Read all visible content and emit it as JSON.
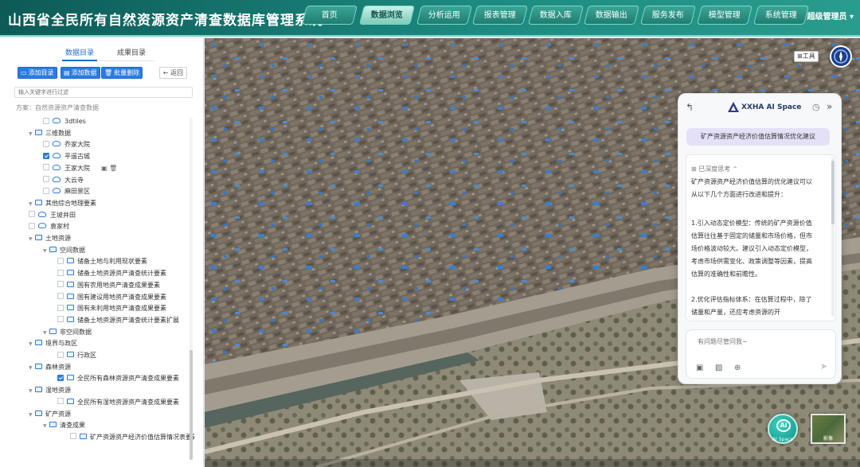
{
  "header": {
    "title": "山西省全民所有自然资源资产清查数据库管理系统",
    "nav": [
      {
        "label": "首页",
        "active": false
      },
      {
        "label": "数据浏览",
        "active": true
      },
      {
        "label": "分析运用",
        "active": false
      },
      {
        "label": "报表管理",
        "active": false
      },
      {
        "label": "数据入库",
        "active": false
      },
      {
        "label": "数据输出",
        "active": false
      },
      {
        "label": "服务发布",
        "active": false
      },
      {
        "label": "模型管理",
        "active": false
      },
      {
        "label": "系统管理",
        "active": false
      }
    ],
    "user": "超级管理员",
    "user_caret": "▾"
  },
  "sidebar": {
    "tabs": [
      {
        "label": "数据目录",
        "active": true
      },
      {
        "label": "成果目录",
        "active": false
      }
    ],
    "buttons": {
      "add_dir": "添加目录",
      "add_data": "添加数据",
      "batch_delete": "批量删除",
      "back": "返回"
    },
    "search_placeholder": "输入关键字进行过滤",
    "scheme": "方案：自然资源资产清查数据",
    "tree": [
      {
        "label": "3dtiles",
        "checked": false,
        "icon": "model"
      },
      {
        "label": "三维数据",
        "checked": false,
        "icon": "folder",
        "open": true
      },
      {
        "label": "乔家大院",
        "checked": false,
        "icon": "model"
      },
      {
        "label": "平遥古城",
        "checked": true,
        "icon": "model"
      },
      {
        "label": "王家大院",
        "checked": false,
        "icon": "model",
        "tools": "▣ 🗑"
      },
      {
        "label": "大云寺",
        "checked": false,
        "icon": "model"
      },
      {
        "label": "麻田景区",
        "checked": false,
        "icon": "model"
      },
      {
        "label": "其他综合地理要素",
        "checked": false,
        "icon": "folder"
      },
      {
        "label": "王坡井田",
        "checked": false,
        "icon": "model"
      },
      {
        "label": "袁家村",
        "checked": false,
        "icon": "model"
      },
      {
        "label": "土地资源",
        "checked": false,
        "icon": "folder",
        "open": true
      },
      {
        "label": "空间数据",
        "checked": false,
        "icon": "folder",
        "open": true
      },
      {
        "label": "储备土地与利用现状要素",
        "checked": false,
        "icon": "folder"
      },
      {
        "label": "储备土地资源资产清查统计要素",
        "checked": false,
        "icon": "folder"
      },
      {
        "label": "国有农用地资产清查成果要素",
        "checked": false,
        "icon": "folder"
      },
      {
        "label": "国有建设用地资产清查成果要素",
        "checked": false,
        "icon": "folder"
      },
      {
        "label": "国有未利用地资产清查成果要素",
        "checked": false,
        "icon": "folder"
      },
      {
        "label": "储备土地资源资产清查统计要素扩展",
        "checked": false,
        "icon": "folder"
      },
      {
        "label": "非空间数据",
        "checked": false,
        "icon": "folder"
      },
      {
        "label": "境界与政区",
        "checked": false,
        "icon": "folder",
        "open": true
      },
      {
        "label": "行政区",
        "checked": false,
        "icon": "folder"
      },
      {
        "label": "森林资源",
        "checked": false,
        "icon": "folder",
        "open": true
      },
      {
        "label": "全民所有森林资源资产清查成果要素",
        "checked": true,
        "icon": "folder"
      },
      {
        "label": "湿地资源",
        "checked": false,
        "icon": "folder",
        "open": true
      },
      {
        "label": "全民所有湿地资源资产清查成果要素",
        "checked": false,
        "icon": "folder"
      },
      {
        "label": "矿产资源",
        "checked": false,
        "icon": "folder",
        "open": true
      },
      {
        "label": "清查成果",
        "checked": false,
        "icon": "folder",
        "open": true
      },
      {
        "label": "矿产资源资产经济价值估算情况表要素",
        "checked": false,
        "icon": "folder"
      }
    ],
    "collapse_icon": "‹"
  },
  "map": {
    "tool_label": "工具",
    "tool_icon": "⊞",
    "minimap_label": "影像"
  },
  "chat": {
    "back_icon": "↰",
    "title": "XXHA AI Space",
    "history_icon": "◷",
    "collapse_icon": "»",
    "user_message": "矿产资源资产经济价值估算情况优化建议",
    "thinking_label": "已深度思考 ⌃",
    "reply_intro": "矿产资源资产经济价值估算的优化建议可以从以下几个方面进行改进和提升：",
    "points": [
      "1.引入动态定价模型：传统的矿产资源价值估算往往基于固定的储量和市场价格，但市场价格波动较大。建议引入动态定价模型，考虑市场供需变化、政策调整等因素，提高估算的准确性和前瞻性。",
      "2.优化评估指标体系：在估算过程中，除了储量和产量，还应考虑资源的开"
    ],
    "input_placeholder": "有问题尽管问我~",
    "send_icon": "➤",
    "fab_mark": "Ai",
    "fab_label": "AI Space"
  }
}
